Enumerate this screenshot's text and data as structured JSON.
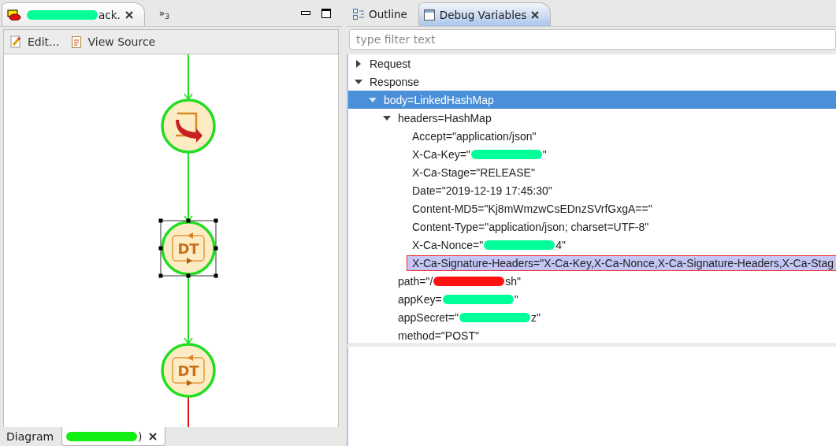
{
  "editor": {
    "tabs": [
      {
        "after": "ack.",
        "color": "#00ff99",
        "selected": true
      }
    ],
    "overflow": {
      "symbol": "»",
      "count": "3"
    },
    "toolbar": [
      {
        "kind": "edit",
        "label": "Edit..."
      },
      {
        "kind": "source",
        "label": "View Source"
      }
    ],
    "diagram": {
      "nodes": [
        {
          "kind": "transform",
          "selected": false
        },
        {
          "kind": "dt",
          "label": "DT",
          "selected": true
        },
        {
          "kind": "dt",
          "label": "DT",
          "selected": false
        }
      ],
      "edges": [
        {
          "color": "#22dd22"
        },
        {
          "color": "#22dd22"
        },
        {
          "color": "#22dd22"
        },
        {
          "color": "#ee1111"
        }
      ]
    },
    "bottom_tabs": [
      {
        "before": "Diagram",
        "selected": false,
        "closable": false
      },
      {
        "after": ")",
        "color": "#11ee11",
        "selected": true,
        "closable": true
      }
    ]
  },
  "debug": {
    "tabs": [
      {
        "kind": "outline",
        "label": "Outline",
        "selected": false
      },
      {
        "kind": "variables",
        "label": "Debug Variables",
        "selected": true
      }
    ],
    "filter": {
      "placeholder": "type filter text"
    },
    "tree": [
      {
        "before": "Request",
        "expanded": false,
        "selected": false,
        "marked": false
      },
      {
        "before": "Response",
        "expanded": true,
        "selected": false,
        "marked": false,
        "children": [
          {
            "before": "body=LinkedHashMap",
            "expanded": true,
            "selected": true,
            "marked": false,
            "children": [
              {
                "before": "headers=HashMap",
                "expanded": true,
                "selected": false,
                "marked": false,
                "children": [
                  {
                    "before": "Accept=\"application/json\"",
                    "selected": false,
                    "marked": false
                  },
                  {
                    "before": "X-Ca-Key=\"",
                    "after": "\"",
                    "color": "#00ff99",
                    "selected": false,
                    "marked": false
                  },
                  {
                    "before": "X-Ca-Stage=\"RELEASE\"",
                    "selected": false,
                    "marked": false
                  },
                  {
                    "before": "Date=\"2019-12-19 17:45:30\"",
                    "selected": false,
                    "marked": false
                  },
                  {
                    "before": "Content-MD5=\"Kj8mWmzwCsEDnzSVrfGxgA==\"",
                    "selected": false,
                    "marked": false
                  },
                  {
                    "before": "Content-Type=\"application/json; charset=UTF-8\"",
                    "selected": false,
                    "marked": false
                  },
                  {
                    "before": "X-Ca-Nonce=\"",
                    "after": "4\"",
                    "color": "#00ff99",
                    "selected": false,
                    "marked": false
                  },
                  {
                    "before": "X-Ca-Signature-Headers=\"X-Ca-Key,X-Ca-Nonce,X-Ca-Signature-Headers,X-Ca-Stag",
                    "selected": false,
                    "marked": true
                  }
                ]
              },
              {
                "before": "path=\"/",
                "after": "sh\"",
                "color": "#ff1111",
                "selected": false,
                "marked": false
              },
              {
                "before": "appKey=",
                "after": "\"",
                "color": "#00ff99",
                "selected": false,
                "marked": false
              },
              {
                "before": "appSecret=\"",
                "after": "z\"",
                "color": "#00ff99",
                "selected": false,
                "marked": false
              },
              {
                "before": "method=\"POST\"",
                "selected": false,
                "marked": false
              }
            ]
          }
        ]
      }
    ]
  }
}
